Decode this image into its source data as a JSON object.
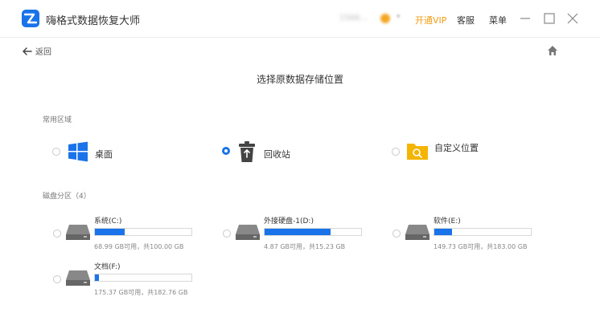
{
  "app": {
    "title": "嗨格式数据恢复大师"
  },
  "header": {
    "user_name": "1566...",
    "vip_label": "开通VIP",
    "service_label": "客服",
    "menu_label": "菜单",
    "vip_color": "#f39c12"
  },
  "nav": {
    "back_label": "返回"
  },
  "page": {
    "title": "选择原数据存储位置"
  },
  "common": {
    "label": "常用区域",
    "options": [
      {
        "label": "桌面",
        "icon": "windows-icon",
        "selected": false
      },
      {
        "label": "回收站",
        "icon": "recycle-bin-icon",
        "selected": true
      },
      {
        "label": "自定义位置",
        "icon": "custom-folder-icon",
        "selected": false
      }
    ]
  },
  "disks": {
    "label": "磁盘分区（4）",
    "items": [
      {
        "name": "系统(C:)",
        "info": "68.99 GB可用，共100.00 GB",
        "used_fraction": 0.31
      },
      {
        "name": "外接硬盘-1(D:)",
        "info": "4.87 GB可用，共15.23 GB",
        "used_fraction": 0.68
      },
      {
        "name": "软件(E:)",
        "info": "149.73 GB可用，共183.00 GB",
        "used_fraction": 0.18
      },
      {
        "name": "文档(F:)",
        "info": "175.37 GB可用，共182.76 GB",
        "used_fraction": 0.04
      }
    ]
  },
  "colors": {
    "accent": "#1a73e8",
    "folder": "#f5b400"
  }
}
